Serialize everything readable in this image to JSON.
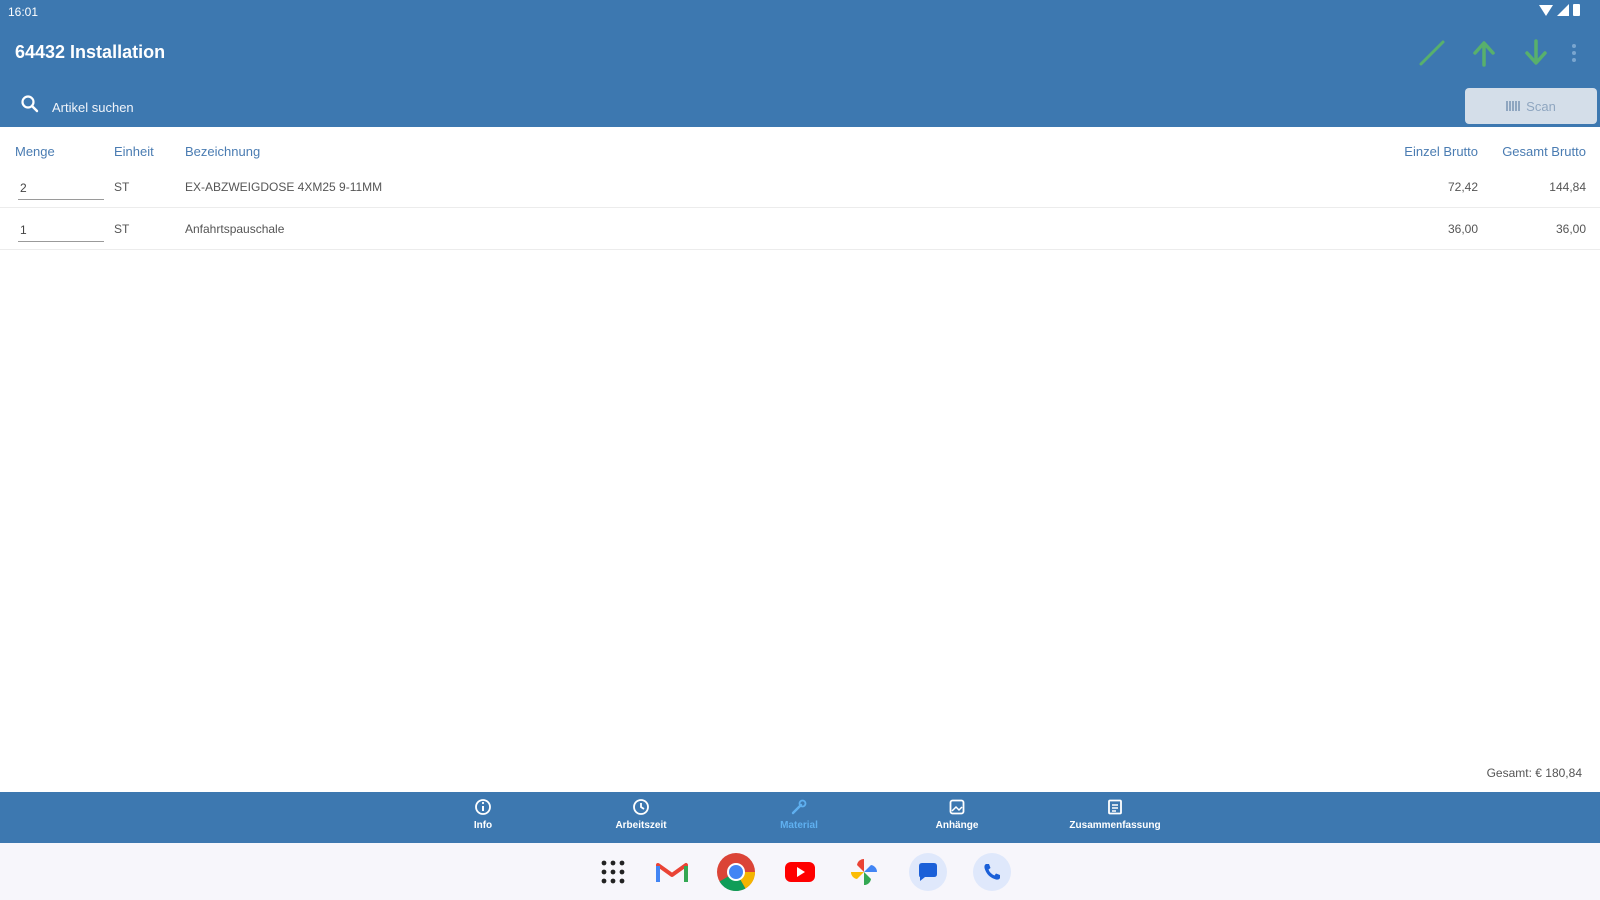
{
  "status": {
    "time": "16:01"
  },
  "header": {
    "title": "64432 Installation",
    "icons": [
      "pencil-icon",
      "arrow-up-icon",
      "arrow-down-icon",
      "more-vert-icon"
    ],
    "colors": {
      "background": "#3d78b0",
      "accent_green": "#58b06c"
    }
  },
  "search": {
    "placeholder": "Artikel suchen",
    "scan_label": "Scan"
  },
  "table": {
    "headers": {
      "menge": "Menge",
      "einheit": "Einheit",
      "bezeichnung": "Bezeichnung",
      "einzel": "Einzel Brutto",
      "gesamt": "Gesamt Brutto"
    },
    "rows": [
      {
        "menge": "2",
        "einheit": "ST",
        "bezeichnung": "EX-ABZWEIGDOSE 4XM25 9-11MM",
        "einzel": "72,42",
        "gesamt": "144,84"
      },
      {
        "menge": "1",
        "einheit": "ST",
        "bezeichnung": "Anfahrtspauschale",
        "einzel": "36,00",
        "gesamt": "36,00"
      }
    ]
  },
  "total": {
    "label": "Gesamt:",
    "value": "€ 180,84"
  },
  "bottom_nav": {
    "items": [
      {
        "label": "Info",
        "icon": "info-icon"
      },
      {
        "label": "Arbeitszeit",
        "icon": "clock-icon"
      },
      {
        "label": "Material",
        "icon": "wrench-icon",
        "active": true
      },
      {
        "label": "Anhänge",
        "icon": "image-icon"
      },
      {
        "label": "Zusammenfassung",
        "icon": "summary-icon"
      }
    ]
  },
  "dock": {
    "apps": [
      "app-drawer",
      "gmail",
      "chrome",
      "youtube",
      "photos",
      "messages",
      "phone"
    ]
  }
}
